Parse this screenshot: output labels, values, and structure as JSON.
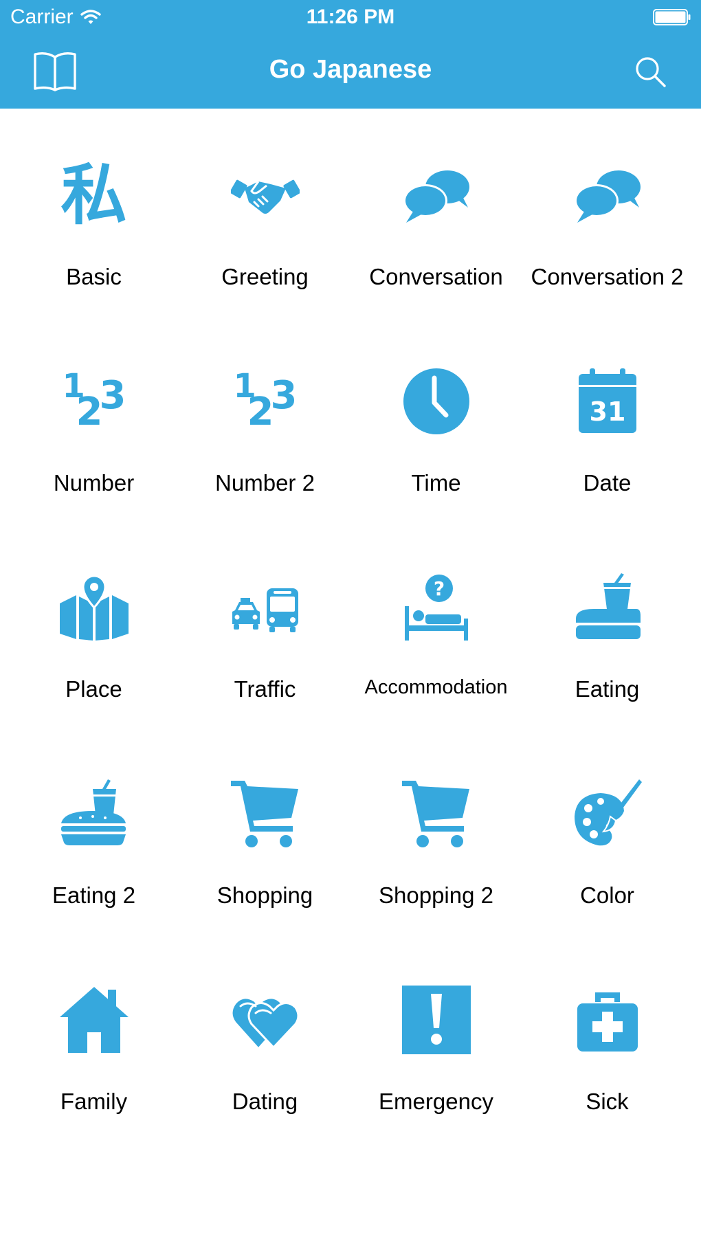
{
  "status_bar": {
    "carrier": "Carrier",
    "time": "11:26 PM",
    "wifi_icon": "wifi-icon",
    "battery_icon": "battery-icon"
  },
  "nav_bar": {
    "title": "Go Japanese",
    "left_icon": "book-icon",
    "right_icon": "search-icon",
    "background_color": "#36a8dd"
  },
  "accent_color": "#36a8dd",
  "categories": [
    {
      "label": "Basic",
      "icon": "kanji-watashi-icon",
      "glyph": "私"
    },
    {
      "label": "Greeting",
      "icon": "handshake-icon"
    },
    {
      "label": "Conversation",
      "icon": "speech-bubbles-icon"
    },
    {
      "label": "Conversation 2",
      "icon": "speech-bubbles-icon"
    },
    {
      "label": "Number",
      "icon": "numbers-123-icon",
      "digits": [
        "1",
        "2",
        "3"
      ]
    },
    {
      "label": "Number 2",
      "icon": "numbers-123-icon",
      "digits": [
        "1",
        "2",
        "3"
      ]
    },
    {
      "label": "Time",
      "icon": "clock-icon"
    },
    {
      "label": "Date",
      "icon": "calendar-icon",
      "day": "31"
    },
    {
      "label": "Place",
      "icon": "map-pin-icon"
    },
    {
      "label": "Traffic",
      "icon": "taxi-bus-icon"
    },
    {
      "label": "Accommodation",
      "icon": "bed-question-icon"
    },
    {
      "label": "Eating",
      "icon": "drink-cup-icon"
    },
    {
      "label": "Eating 2",
      "icon": "burger-drink-icon"
    },
    {
      "label": "Shopping",
      "icon": "shopping-cart-icon"
    },
    {
      "label": "Shopping 2",
      "icon": "shopping-cart-icon"
    },
    {
      "label": "Color",
      "icon": "palette-icon"
    },
    {
      "label": "Family",
      "icon": "house-icon"
    },
    {
      "label": "Dating",
      "icon": "hearts-icon"
    },
    {
      "label": "Emergency",
      "icon": "exclamation-icon"
    },
    {
      "label": "Sick",
      "icon": "first-aid-kit-icon"
    }
  ]
}
